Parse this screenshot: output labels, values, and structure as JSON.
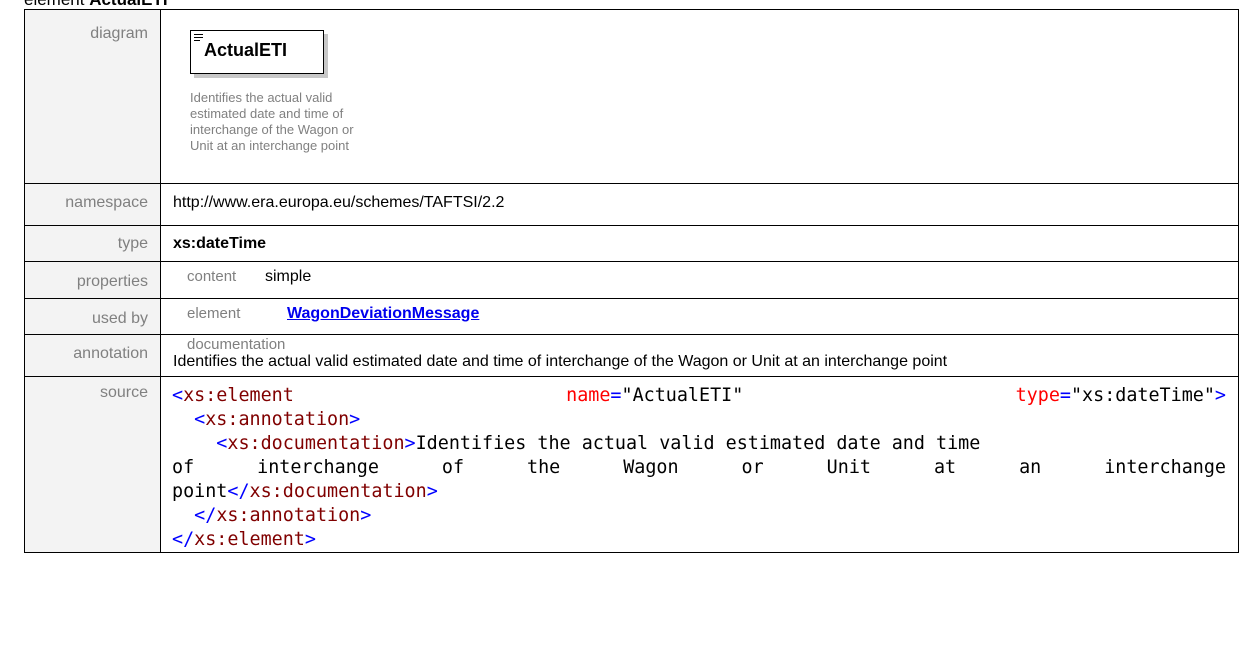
{
  "heading": {
    "prefix": "element ",
    "name": "ActualETI"
  },
  "labels": {
    "diagram": "diagram",
    "namespace": "namespace",
    "type": "type",
    "properties": "properties",
    "used_by": "used by",
    "annotation": "annotation",
    "source": "source"
  },
  "diagram": {
    "element_name": "ActualETI",
    "doc": "Identifies the actual valid estimated date and time of interchange of the Wagon or Unit at an interchange point"
  },
  "namespace": "http://www.era.europa.eu/schemes/TAFTSI/2.2",
  "type": "xs:dateTime",
  "properties": {
    "key": "content",
    "value": "simple"
  },
  "used_by": {
    "key": "element",
    "value": "WagonDeviationMessage"
  },
  "annotation": {
    "key": "documentation",
    "value": "Identifies the actual valid estimated date and time of interchange of the Wagon or Unit at an interchange point"
  },
  "source": {
    "l1_open": "<",
    "l1_tag": "xs:element",
    "l1_attr1": "name",
    "l1_eq1": "=",
    "l1_val1": "\"ActualETI\"",
    "l1_attr2": "type",
    "l1_eq2": "=",
    "l1_val2": "\"xs:dateTime\"",
    "l1_close": ">",
    "l2_open": "<",
    "l2_tag": "xs:annotation",
    "l2_close": ">",
    "l3_open": "<",
    "l3_tag": "xs:documentation",
    "l3_close": ">",
    "l3_text": "Identifies the actual valid estimated date and time",
    "l4_words": [
      "of",
      "interchange",
      "of",
      "the",
      "Wagon",
      "or",
      "Unit",
      "at",
      "an",
      "interchange"
    ],
    "l5_text": "point",
    "l5_open": "</",
    "l5_tag": "xs:documentation",
    "l5_close": ">",
    "l6_open": "</",
    "l6_tag": "xs:annotation",
    "l6_close": ">",
    "l7_open": "</",
    "l7_tag": "xs:element",
    "l7_close": ">"
  }
}
